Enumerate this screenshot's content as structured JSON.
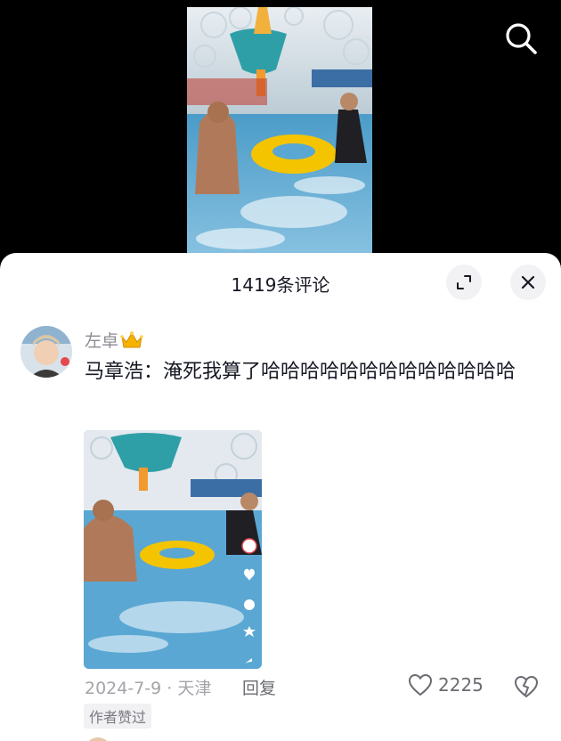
{
  "header": {
    "comment_count_title": "1419条评论"
  },
  "comment": {
    "username": "左卓",
    "badge_icon": "crown-icon",
    "text": "马章浩：淹死我算了哈哈哈哈哈哈哈哈哈哈哈哈哈",
    "date_location": "2024-7-9 · 天津",
    "reply_label": "回复",
    "like_count": "2225",
    "author_badge": "作者赞过"
  },
  "icons": {
    "search": "search-icon",
    "expand": "expand-icon",
    "close": "close-icon",
    "like": "heart-icon",
    "dislike": "broken-heart-icon"
  },
  "colors": {
    "text_primary": "#161823",
    "text_secondary": "#8a8b91",
    "sheet_bg": "#ffffff",
    "video_bg": "#000000",
    "pool_blue": "#5aa7d3",
    "ring_yellow": "#f4c400"
  }
}
